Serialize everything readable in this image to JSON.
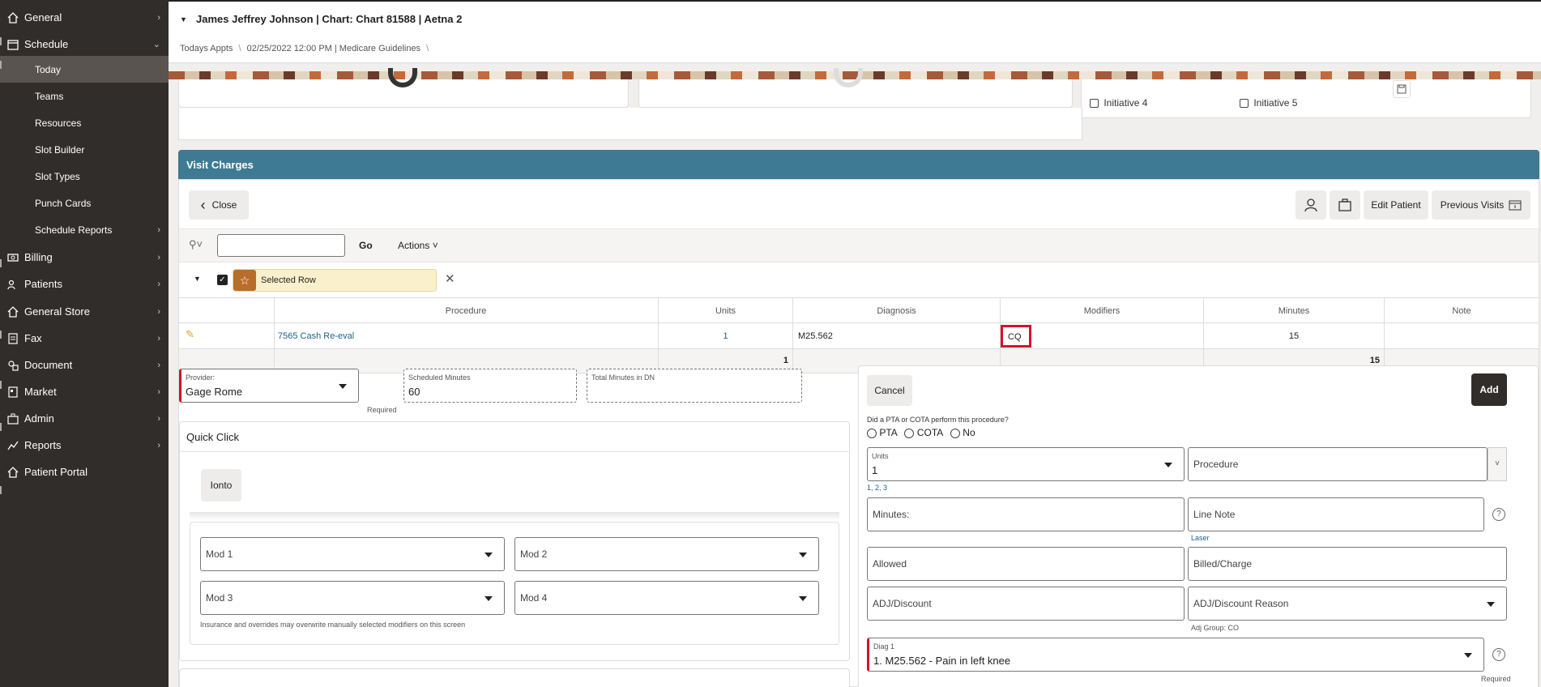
{
  "sidebar": {
    "items": [
      {
        "label": "General",
        "icon": "home-icon"
      },
      {
        "label": "Schedule",
        "icon": "calendar-icon"
      },
      {
        "label": "Billing",
        "icon": "money-icon"
      },
      {
        "label": "Patients",
        "icon": "users-icon"
      },
      {
        "label": "General Store",
        "icon": "home-icon"
      },
      {
        "label": "Fax",
        "icon": "fax-icon"
      },
      {
        "label": "Document",
        "icon": "document-icon"
      },
      {
        "label": "Market",
        "icon": "market-icon"
      },
      {
        "label": "Admin",
        "icon": "admin-icon"
      },
      {
        "label": "Reports",
        "icon": "chart-icon"
      },
      {
        "label": "Patient Portal",
        "icon": "portal-icon"
      }
    ],
    "schedule_sub": [
      "Today",
      "Teams",
      "Resources",
      "Slot Builder",
      "Slot Types",
      "Punch Cards",
      "Schedule Reports"
    ]
  },
  "header": {
    "title": "James Jeffrey Johnson | Chart: Chart 81588 | Aetna 2",
    "breadcrumb": [
      "Todays Appts",
      "02/25/2022 12:00 PM | Medicare Guidelines"
    ]
  },
  "initiatives": [
    "Initiative 4",
    "Initiative 5"
  ],
  "visit_charges": {
    "title": "Visit Charges",
    "close_label": "Close",
    "edit_patient_label": "Edit Patient",
    "previous_visits_label": "Previous Visits",
    "go_label": "Go",
    "actions_label": "Actions",
    "selected_row_label": "Selected Row",
    "columns": [
      "Procedure",
      "Units",
      "Diagnosis",
      "Modifiers",
      "Minutes",
      "Note"
    ],
    "rows": [
      {
        "procedure": "7565 Cash Re-eval",
        "units": "1",
        "diagnosis": "M25.562",
        "modifiers": "CQ",
        "minutes": "15",
        "note": ""
      }
    ],
    "totals": {
      "units": "1",
      "minutes": "15"
    }
  },
  "left_form": {
    "provider_label": "Provider:",
    "provider_value": "Gage Rome",
    "required_label": "Required",
    "scheduled_minutes_label": "Scheduled Minutes",
    "scheduled_minutes_value": "60",
    "total_minutes_label": "Total Minutes in DN",
    "quick_click_title": "Quick Click",
    "ionto_label": "Ionto",
    "mods": [
      "Mod 1",
      "Mod 2",
      "Mod 3",
      "Mod 4"
    ],
    "mods_note": "Insurance and overrides may overwrite manually selected modifiers on this screen"
  },
  "right_form": {
    "cancel_label": "Cancel",
    "add_label": "Add",
    "question": "Did a PTA or COTA perform this procedure?",
    "radio_options": [
      "PTA",
      "COTA",
      "No"
    ],
    "units_label": "Units",
    "units_value": "1",
    "units_hint": "1, 2, 3",
    "procedure_placeholder": "Procedure",
    "minutes_placeholder": "Minutes:",
    "line_note_placeholder": "Line Note",
    "line_note_hint": "Laser",
    "allowed_placeholder": "Allowed",
    "billed_placeholder": "Billed/Charge",
    "adj_placeholder": "ADJ/Discount",
    "adj_reason_placeholder": "ADJ/Discount Reason",
    "adj_group_hint": "Adj Group: CO",
    "diag_label": "Diag 1",
    "diag_value": "1. M25.562 - Pain in left knee",
    "diag_hint": "Required"
  }
}
